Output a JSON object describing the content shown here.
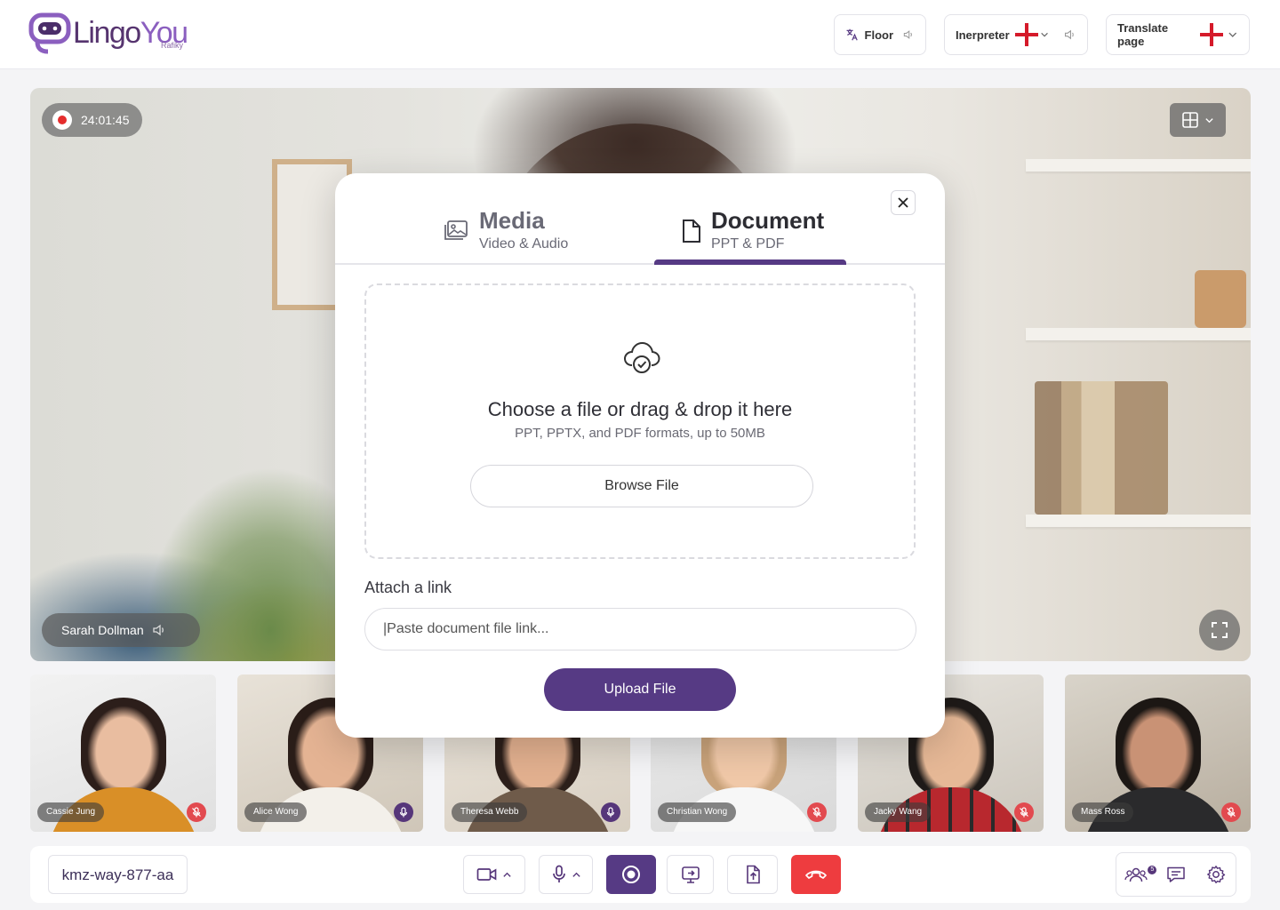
{
  "app": {
    "name_part1": "Lingo",
    "name_part2": "You",
    "subname": "Rafiky"
  },
  "header": {
    "floor_label": "Floor",
    "interpreter_label": "Inerpreter",
    "translate_label": "Translate page"
  },
  "main_video": {
    "recording_time": "24:01:45",
    "speaker_name": "Sarah Dollman"
  },
  "participants": [
    {
      "name": "Cassie Jung",
      "mic": "muted"
    },
    {
      "name": "Alice Wong",
      "mic": "on"
    },
    {
      "name": "Theresa Webb",
      "mic": "on"
    },
    {
      "name": "Christian Wong",
      "mic": "muted"
    },
    {
      "name": "Jacky Wang",
      "mic": "muted"
    },
    {
      "name": "Mass Ross",
      "mic": "muted"
    }
  ],
  "bottom_bar": {
    "room_code": "kmz-way-877-aa",
    "participants_badge": "5"
  },
  "modal": {
    "tabs": [
      {
        "title": "Media",
        "subtitle": "Video & Audio",
        "active": false
      },
      {
        "title": "Document",
        "subtitle": "PPT & PDF",
        "active": true
      }
    ],
    "dropzone_title": "Choose a file or drag & drop it here",
    "dropzone_subtitle": "PPT, PPTX, and PDF formats, up to 50MB",
    "browse_label": "Browse File",
    "link_label": "Attach a link",
    "link_placeholder": "|Paste document file link...",
    "upload_label": "Upload File"
  },
  "colors": {
    "brand": "#563a84",
    "danger": "#ee3c3f",
    "muted_mic": "#e24a4f"
  }
}
